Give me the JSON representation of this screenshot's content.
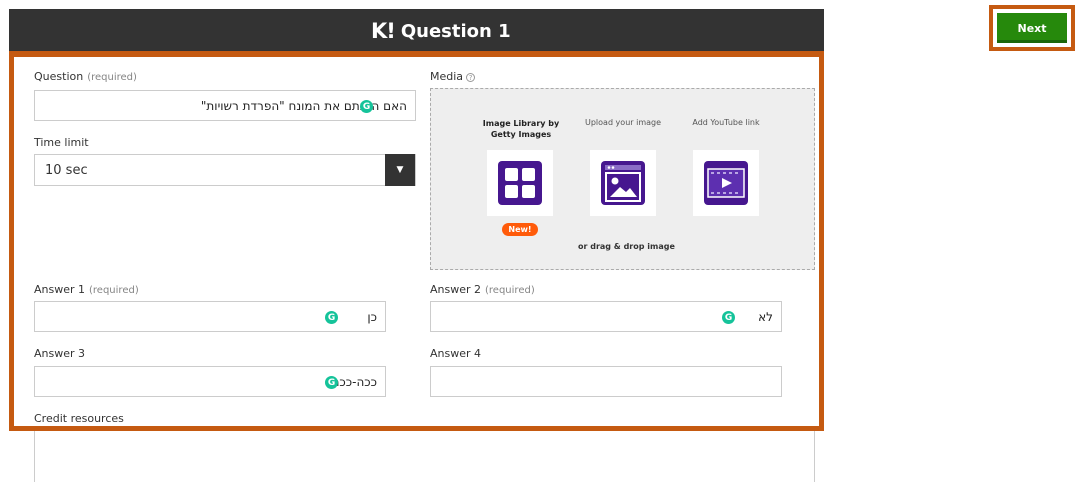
{
  "header": {
    "logo": "K!",
    "title": "Question 1",
    "next_label": "Next"
  },
  "question": {
    "label": "Question",
    "required": "(required)",
    "value": "האם הבנתם את המונח \"הפרדת רשויות\""
  },
  "time_limit": {
    "label": "Time limit",
    "selected": "10 sec"
  },
  "media": {
    "label": "Media",
    "options": [
      {
        "label": "Image Library by Getty Images",
        "icon": "image-library-icon",
        "badge": "New!"
      },
      {
        "label": "Upload your image",
        "icon": "upload-image-icon"
      },
      {
        "label": "Add YouTube link",
        "icon": "youtube-video-icon"
      }
    ],
    "drag_text": "or drag & drop image"
  },
  "answers": [
    {
      "label": "Answer 1",
      "required": "(required)",
      "value": "כן"
    },
    {
      "label": "Answer 2",
      "required": "(required)",
      "value": "לא"
    },
    {
      "label": "Answer 3",
      "required": "",
      "value": "ככה-ככה"
    },
    {
      "label": "Answer 4",
      "required": "",
      "value": ""
    }
  ],
  "credit": {
    "label": "Credit resources"
  },
  "grammarly_glyph": "G",
  "colors": {
    "header_bg": "#333333",
    "next_green": "#26890c",
    "highlight_orange": "#c55a11",
    "media_purple": "#46178f",
    "grammarly_green": "#15c39a",
    "badge_orange": "#ff5b0a"
  }
}
